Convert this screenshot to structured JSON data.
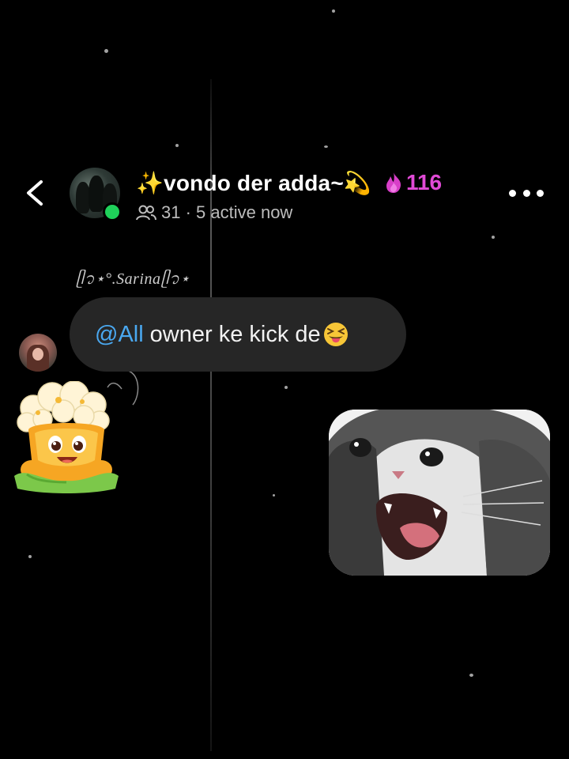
{
  "header": {
    "back_icon": "chevron-left-icon",
    "group_title": "✨vondo der adda~💫",
    "streak_icon": "fire-icon",
    "streak_count": "116",
    "members_icon": "people-icon",
    "members_text": "31 · 5 active now",
    "more_icon": "more-dots-icon"
  },
  "message": {
    "sender_name": "ᥫ᭡⋆°.Sarinaᥫ᭡⋆",
    "mention": "@All",
    "text": "owner ke kick de"
  },
  "colors": {
    "background": "#000000",
    "bubble": "#262626",
    "mention": "#4aa8f0",
    "streak": "#e14ad6",
    "online": "#1fd15a"
  }
}
